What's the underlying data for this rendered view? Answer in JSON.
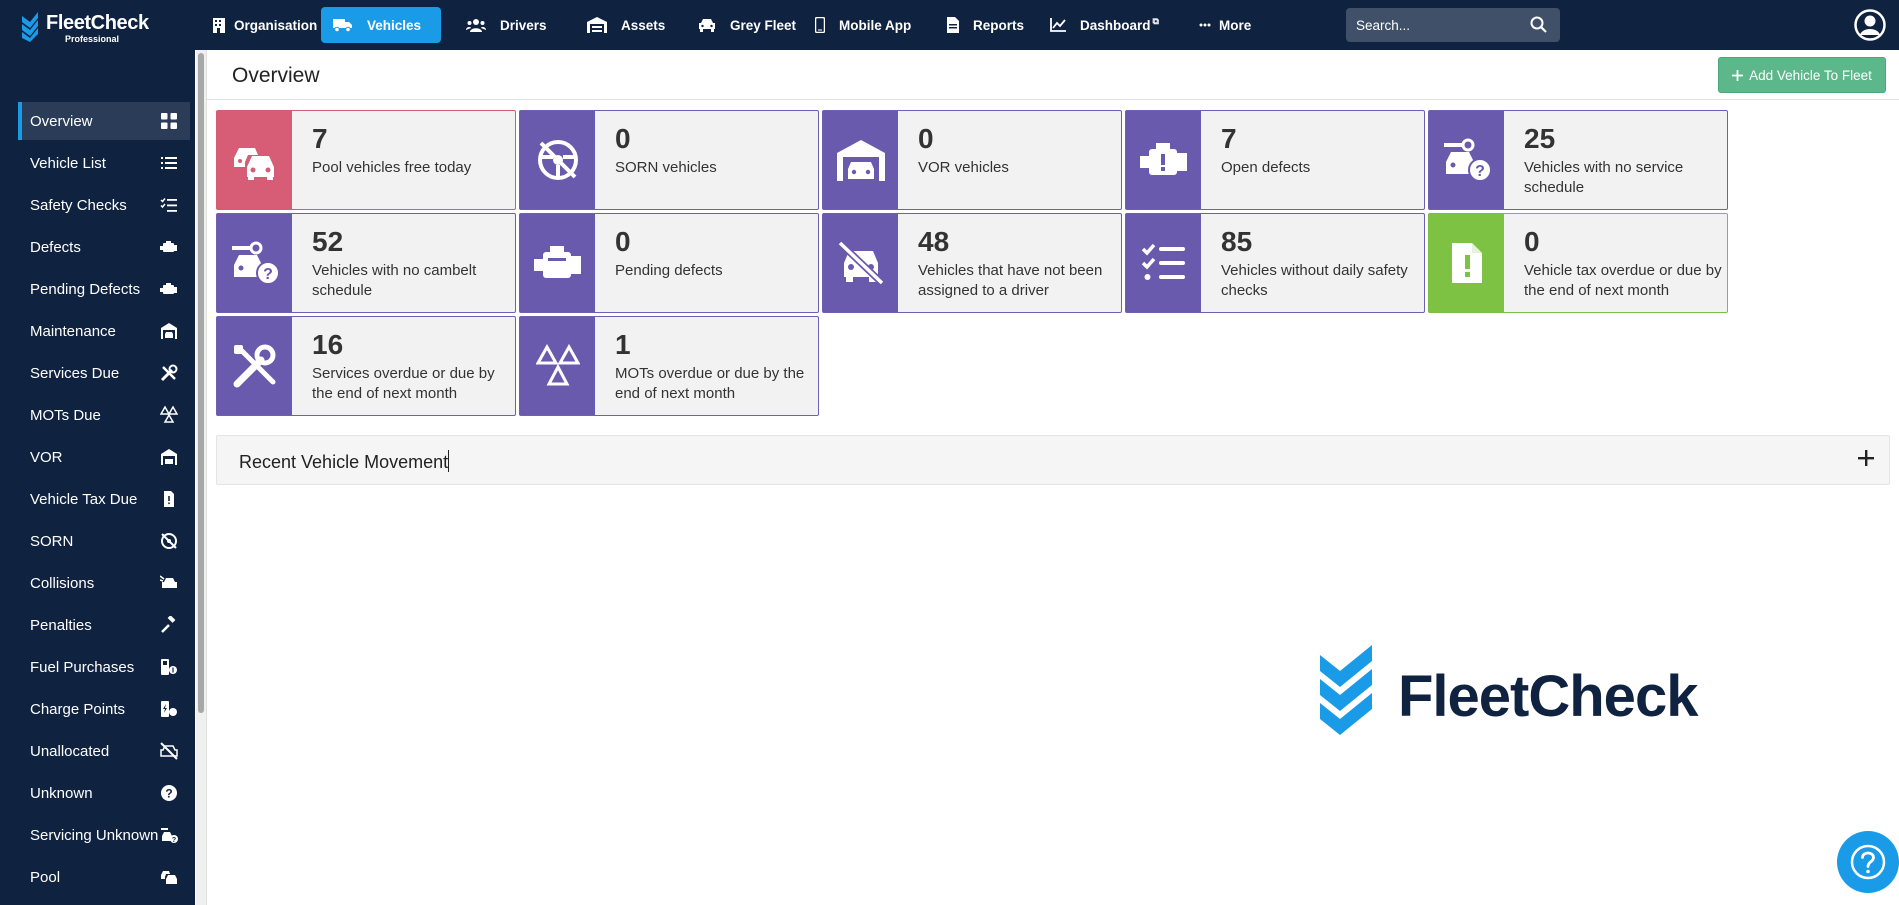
{
  "brand": {
    "name": "FleetCheck",
    "edition": "Professional"
  },
  "topnav": {
    "items": [
      {
        "label": "Organisation",
        "icon": "building-icon"
      },
      {
        "label": "Vehicles",
        "icon": "truck-icon",
        "active": true
      },
      {
        "label": "Drivers",
        "icon": "users-icon"
      },
      {
        "label": "Assets",
        "icon": "warehouse-icon"
      },
      {
        "label": "Grey Fleet",
        "icon": "car-icon"
      },
      {
        "label": "Mobile App",
        "icon": "mobile-icon"
      },
      {
        "label": "Reports",
        "icon": "report-icon"
      },
      {
        "label": "Dashboard",
        "icon": "chart-line-icon",
        "external": "⧉"
      },
      {
        "label": "More",
        "icon": "ellipsis-icon"
      }
    ],
    "search_placeholder": "Search..."
  },
  "sidebar": {
    "items": [
      {
        "label": "Overview",
        "icon": "grid-icon",
        "active": true
      },
      {
        "label": "Vehicle List",
        "icon": "list-icon"
      },
      {
        "label": "Safety Checks",
        "icon": "checklist-icon"
      },
      {
        "label": "Defects",
        "icon": "engine-icon"
      },
      {
        "label": "Pending Defects",
        "icon": "engine-icon"
      },
      {
        "label": "Maintenance",
        "icon": "car-garage-icon"
      },
      {
        "label": "Services Due",
        "icon": "tools-icon"
      },
      {
        "label": "MOTs Due",
        "icon": "triangles-icon"
      },
      {
        "label": "VOR",
        "icon": "garage-icon"
      },
      {
        "label": "Vehicle Tax Due",
        "icon": "file-exclamation-icon"
      },
      {
        "label": "SORN",
        "icon": "no-drive-icon"
      },
      {
        "label": "Collisions",
        "icon": "car-crash-icon"
      },
      {
        "label": "Penalties",
        "icon": "gavel-icon"
      },
      {
        "label": "Fuel Purchases",
        "icon": "fuel-pump-icon"
      },
      {
        "label": "Charge Points",
        "icon": "charge-point-icon"
      },
      {
        "label": "Unallocated",
        "icon": "car-slash-icon"
      },
      {
        "label": "Unknown",
        "icon": "question-circle-icon"
      },
      {
        "label": "Servicing Unknown",
        "icon": "car-wrench-question-icon"
      },
      {
        "label": "Pool",
        "icon": "cars-icon"
      }
    ]
  },
  "main": {
    "title": "Overview",
    "add_button": "Add Vehicle To Fleet",
    "cards": [
      {
        "value": "7",
        "label": "Pool vehicles free today",
        "icon": "cars-icon",
        "color": "#d65d75"
      },
      {
        "value": "0",
        "label": "SORN vehicles",
        "icon": "no-drive-icon",
        "color": "#6a5aad"
      },
      {
        "value": "0",
        "label": "VOR vehicles",
        "icon": "garage-icon",
        "color": "#6a5aad"
      },
      {
        "value": "7",
        "label": "Open defects",
        "icon": "engine-warning-icon",
        "color": "#6a5aad"
      },
      {
        "value": "25",
        "label": "Vehicles with no service schedule",
        "icon": "car-wrench-question-icon",
        "color": "#6a5aad"
      },
      {
        "value": "52",
        "label": "Vehicles with no cambelt schedule",
        "icon": "car-wrench-question-icon",
        "color": "#6a5aad"
      },
      {
        "value": "0",
        "label": "Pending defects",
        "icon": "engine-icon",
        "color": "#6a5aad"
      },
      {
        "value": "48",
        "label": "Vehicles that have not been assigned to a driver",
        "icon": "car-slash-icon",
        "color": "#6a5aad"
      },
      {
        "value": "85",
        "label": "Vehicles without daily safety checks",
        "icon": "checklist-icon",
        "color": "#6a5aad"
      },
      {
        "value": "0",
        "label": "Vehicle tax overdue or due by the end of next month",
        "icon": "file-exclamation-icon",
        "color": "#7dc242"
      },
      {
        "value": "16",
        "label": "Services overdue or due by the end of next month",
        "icon": "tools-icon",
        "color": "#6a5aad"
      },
      {
        "value": "1",
        "label": "MOTs overdue or due by the end of next month",
        "icon": "triangles-icon",
        "color": "#6a5aad"
      }
    ],
    "recent_section": {
      "title": "Recent Vehicle Movement",
      "toggle": "+"
    }
  },
  "colors": {
    "nav_bg": "#0f2240",
    "accent": "#1a9be8",
    "card_purple": "#6a5aad",
    "card_pink": "#d65d75",
    "card_green": "#7dc242",
    "add_button": "#5cb88a"
  }
}
